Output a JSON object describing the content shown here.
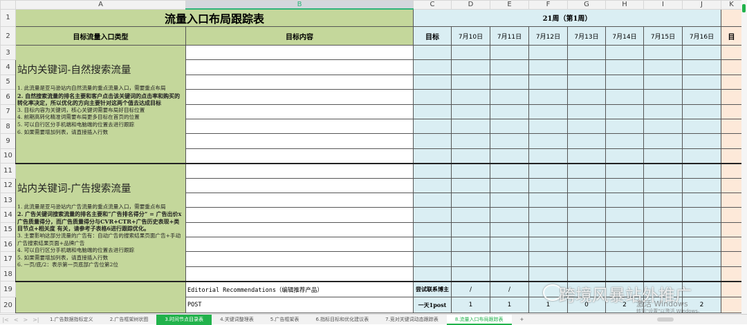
{
  "columns": [
    "A",
    "B",
    "C",
    "D",
    "E",
    "F",
    "G",
    "H",
    "I",
    "J",
    "K"
  ],
  "title": "流量入口布局跟踪表",
  "week_label": "21周（第1周）",
  "headers": {
    "type": "目标流量入口类型",
    "content": "目标内容",
    "target": "目标",
    "k_partial": "目"
  },
  "dates": [
    "7月10日",
    "7月11日",
    "7月12日",
    "7月13日",
    "7月14日",
    "7月15日",
    "7月16日"
  ],
  "row_numbers": [
    "1",
    "2",
    "3",
    "4",
    "5",
    "6",
    "7",
    "8",
    "9",
    "10",
    "11",
    "12",
    "13",
    "14",
    "15",
    "16",
    "17",
    "18",
    "19",
    "20"
  ],
  "section1": {
    "title": "站内关键词-自然搜索流量",
    "lines": [
      "1. 此流量是亚马逊站内自然流量的重点流量入口，需要重点布局",
      "2. 自然搜索流量的排名主要和客户点击该关键词的点击率和购买的转化率决定，所以优化的方向主要针对这两个值去达成目标",
      "3. 目标内容为关键词，核心关键词需要布局好目标位置",
      "4. 前期高转化精准词需要布局更多目标在首页的位置",
      "5. 可以自行区分手机端和电脑端的位置去进行跟踪",
      "6. 如果需要增加列表，请直接插入行数"
    ]
  },
  "section2": {
    "title": "站内关键词-广告搜索流量",
    "lines": [
      "1. 此流量是亚马逊站内广告流量的重点流量入口，需要重点布局",
      "2. 广告关键词搜索流量的排名主要和“广告排名得分” = 广告出价x广告质量得分，而广告质量得分与CVR+CTR+广告历史表现+类目节点+相关度 有关，请参考子表格6进行跟踪优化。",
      "3. 主要影响这部分流量的广告有：自动广告的搜索结果页面广告+手动广告搜索结果页面+品牌广告",
      "4. 可以自行区分手机端和电脑端的位置去进行跟踪",
      "5. 如果需要增加列表，请直接插入行数",
      "6. 一页/底/2：表示第一页底部广告位第2位"
    ]
  },
  "row19": {
    "content": "Editorial Recommendations（编辑推荐产品）",
    "target": "尝试联系博主",
    "values": [
      "/",
      "/",
      "",
      "",
      "",
      "",
      ""
    ]
  },
  "row20": {
    "content": "POST",
    "target": "一天1post",
    "values": [
      "1",
      "1",
      "1",
      "0",
      "2",
      "",
      "2"
    ]
  },
  "sheet_tabs": [
    "1.广告数据指标定义",
    "2.广告框架树状图",
    "3.时间节点目录表",
    "4.关键词整理表",
    "5.广告框架表",
    "6.指标目标和优化建议表",
    "7.竞对关键词动态跟踪表",
    "8.流量入口布局跟踪表"
  ],
  "tab_nav": [
    "|<",
    "<",
    ">",
    ">|",
    "+"
  ],
  "watermark": "跨境风暴站外推广",
  "activation": {
    "line1": "激活 Windows",
    "line2": "转到\"设置\"以激活 Windows。"
  }
}
